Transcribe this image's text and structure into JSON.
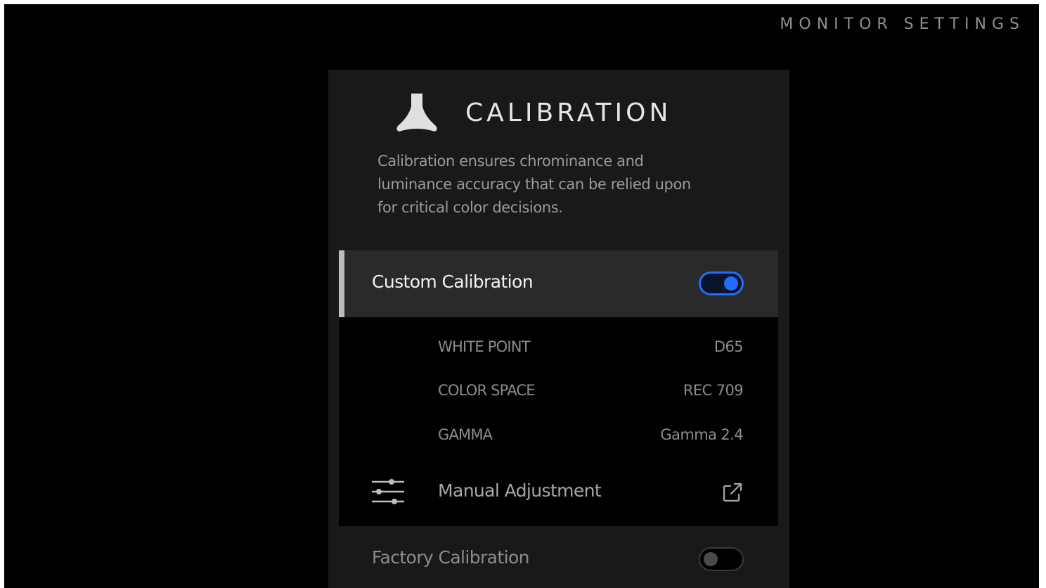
{
  "header": {
    "title": "MONITOR SETTINGS"
  },
  "panel": {
    "logo_icon": "triangle-logo-icon",
    "title": "CALIBRATION",
    "description": "Calibration ensures chrominance and luminance accuracy that can be relied upon for critical color decisions."
  },
  "custom_calibration": {
    "label": "Custom Calibration",
    "enabled": true,
    "settings": [
      {
        "label": "WHITE POINT",
        "value": "D65"
      },
      {
        "label": "COLOR SPACE",
        "value": "REC 709"
      },
      {
        "label": "GAMMA",
        "value": "Gamma 2.4"
      }
    ],
    "manual_adjustment": {
      "label": "Manual Adjustment",
      "icon": "sliders-icon",
      "link_icon": "external-link-icon"
    }
  },
  "factory_calibration": {
    "label": "Factory Calibration",
    "enabled": false
  },
  "colors": {
    "accent": "#1e6fff",
    "background": "#000000",
    "panel": "#191919",
    "selected_row": "#2a2a2a"
  }
}
